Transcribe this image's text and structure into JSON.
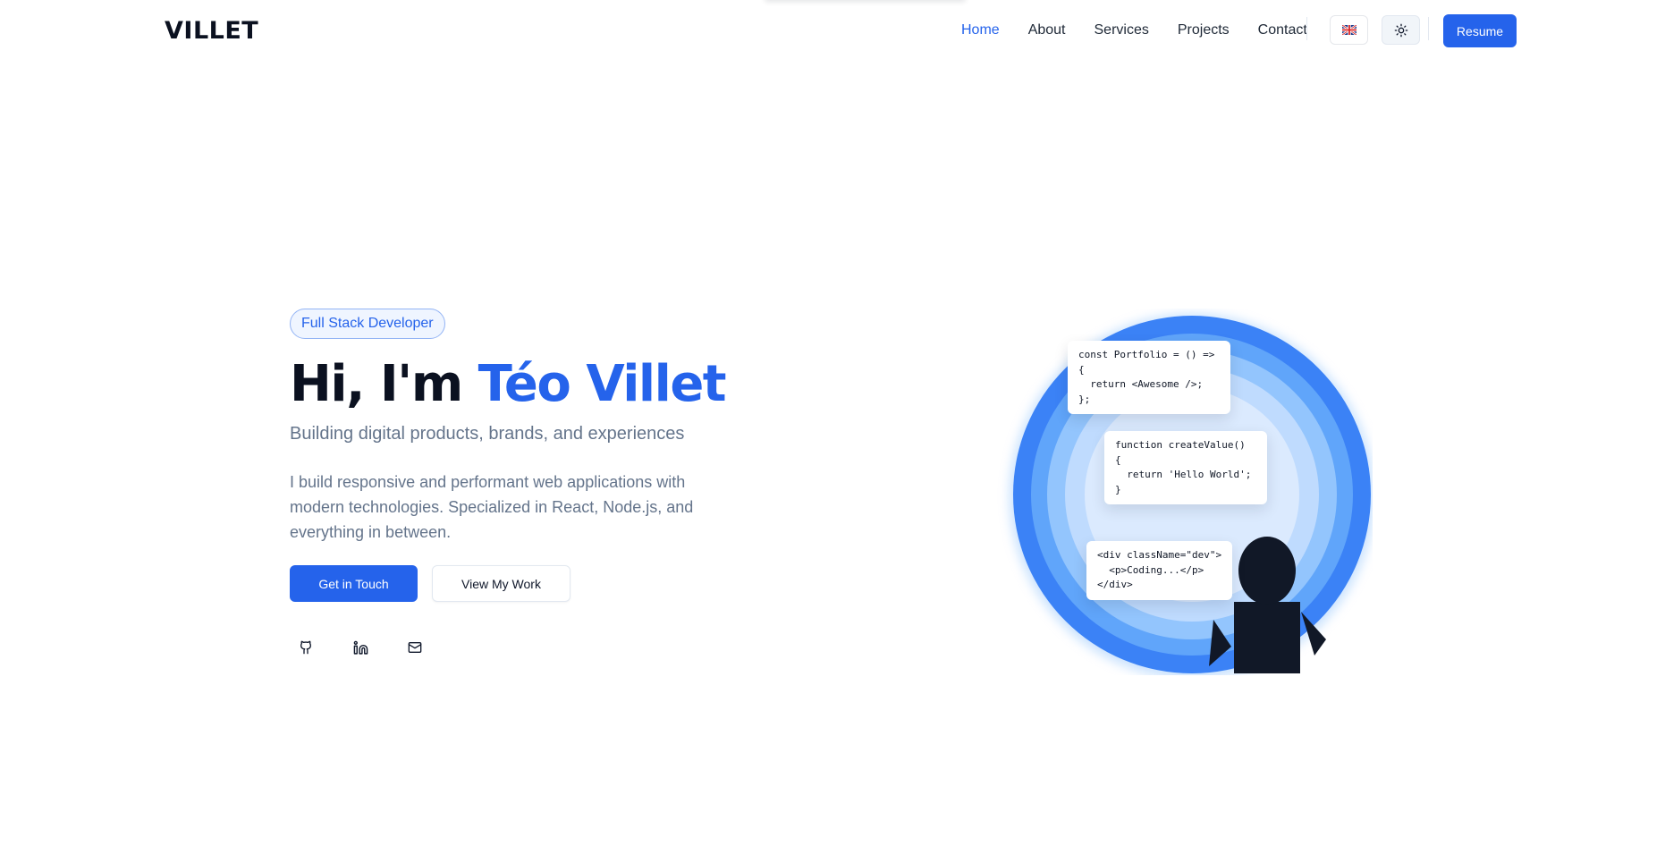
{
  "header": {
    "logo": "VILLET",
    "nav": [
      {
        "label": "Home",
        "active": true
      },
      {
        "label": "About"
      },
      {
        "label": "Services"
      },
      {
        "label": "Projects"
      },
      {
        "label": "Contact"
      }
    ],
    "language_icon": "uk-flag-icon",
    "theme_icon": "sun-icon",
    "resume_label": "Resume"
  },
  "hero": {
    "badge": "Full Stack Developer",
    "title_prefix": "Hi, I'm ",
    "title_name": "Téo Villet",
    "subtitle": "Building digital products, brands, and experiences",
    "description": "I build responsive and performant web applications with modern technologies. Specialized in React, Node.js, and everything in between.",
    "primary_button": "Get in Touch",
    "secondary_button": "View My Work",
    "social": [
      {
        "icon": "github-icon"
      },
      {
        "icon": "linkedin-icon"
      },
      {
        "icon": "mail-icon"
      }
    ]
  },
  "illustration": {
    "code_cards": [
      "const Portfolio = () =>\n{\n  return <Awesome />;\n};",
      "function createValue()\n{\n  return 'Hello World';\n}",
      "<div className=\"dev\">\n  <p>Coding...</p>\n</div>"
    ]
  },
  "colors": {
    "accent": "#2563eb",
    "text_dark": "#0b1120",
    "text_muted": "#64748b"
  }
}
